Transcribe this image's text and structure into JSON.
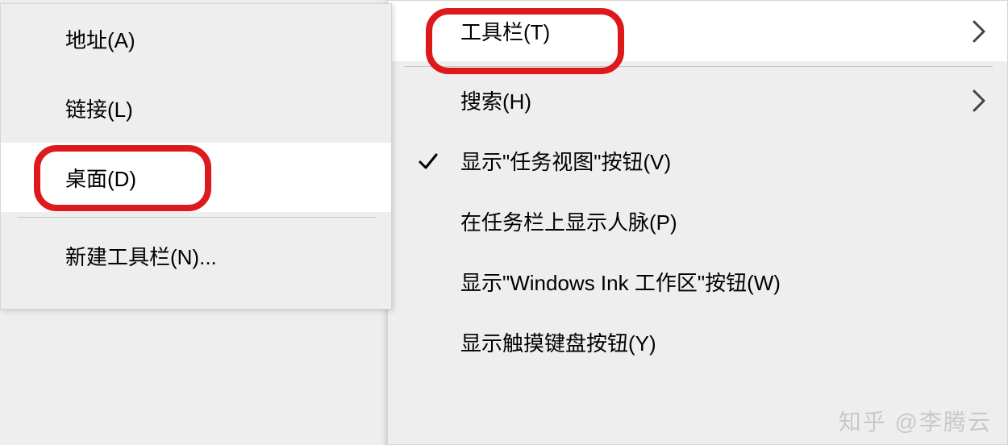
{
  "main_menu": {
    "toolbars": "工具栏(T)",
    "search": "搜索(H)",
    "show_taskview": "显示\"任务视图\"按钮(V)",
    "show_people": "在任务栏上显示人脉(P)",
    "show_ink": "显示\"Windows Ink 工作区\"按钮(W)",
    "show_touch_kb": "显示触摸键盘按钮(Y)"
  },
  "sub_menu": {
    "address": "地址(A)",
    "links": "链接(L)",
    "desktop": "桌面(D)",
    "new_toolbar": "新建工具栏(N)..."
  },
  "watermark": "知乎 @李腾云"
}
